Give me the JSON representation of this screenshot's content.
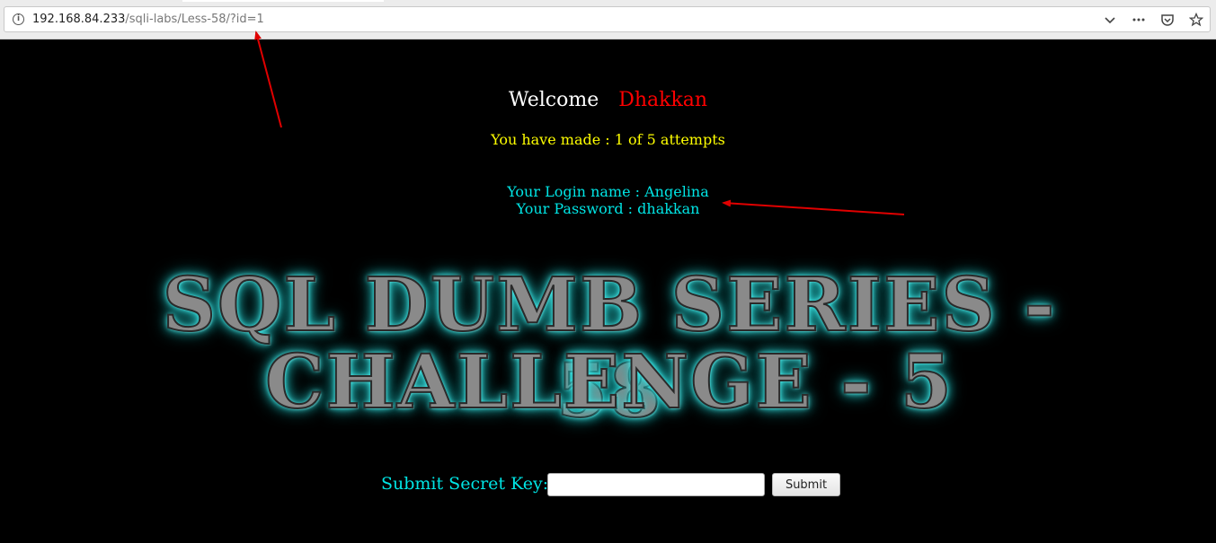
{
  "browser": {
    "url_host": "192.168.84.233",
    "url_path": "/sqli-labs/Less-58/?id=1",
    "icons": {
      "info": "info-icon",
      "dropdown": "chevron-down-icon",
      "more": "more-horizontal-icon",
      "pocket": "pocket-icon",
      "bookmark": "star-icon"
    }
  },
  "page": {
    "welcome_label": "Welcome",
    "welcome_user": "Dhakkan",
    "attempts_text": "You have made : 1 of 5 attempts",
    "login_name_line": "Your Login name : Angelina",
    "password_line": "Your Password : dhakkan",
    "banner_line1": "SQL DUMB SERIES - 58",
    "banner_line2": "CHALLENGE - 5"
  },
  "form": {
    "label": "Submit Secret Key:",
    "input_value": "",
    "submit_label": "Submit"
  },
  "colors": {
    "background": "#000000",
    "welcome_user": "#ff0000",
    "attempts": "#ffff00",
    "login_info": "#00e5e5",
    "annotation_arrow": "#e00000"
  }
}
